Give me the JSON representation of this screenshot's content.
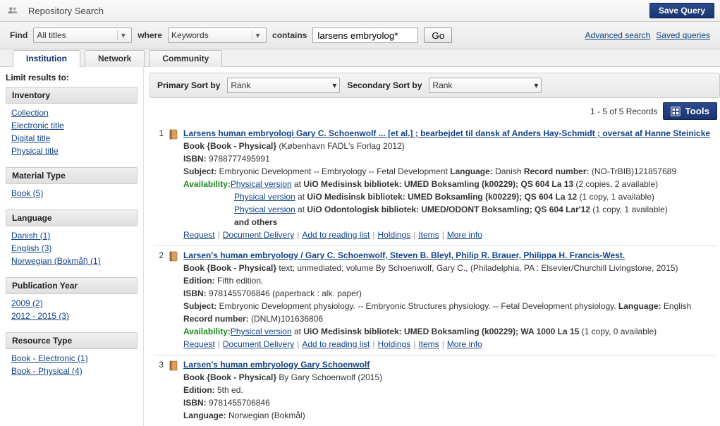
{
  "header": {
    "title": "Repository Search",
    "save_query": "Save Query"
  },
  "search": {
    "find_label": "Find",
    "find_value": "All titles",
    "where_label": "where",
    "where_value": "Keywords",
    "contains_label": "contains",
    "query_value": "larsens embryolog*",
    "go": "Go",
    "advanced": "Advanced search",
    "saved": "Saved queries"
  },
  "tabs": [
    "Institution",
    "Network",
    "Community"
  ],
  "limit_heading": "Limit results to:",
  "facets": [
    {
      "head": "Inventory",
      "items": [
        "Collection",
        "Electronic title",
        "Digital title",
        "Physical title"
      ]
    },
    {
      "head": "Material Type",
      "items": [
        "Book (5)"
      ]
    },
    {
      "head": "Language",
      "items": [
        "Danish (1)",
        "English (3)",
        "Norwegian (Bokmål) (1)"
      ]
    },
    {
      "head": "Publication Year",
      "items": [
        "2009 (2)",
        "2012 - 2015 (3)"
      ]
    },
    {
      "head": "Resource Type",
      "items": [
        "Book - Electronic (1)",
        "Book - Physical (4)"
      ]
    }
  ],
  "sort": {
    "primary_label": "Primary Sort by",
    "primary_value": "Rank",
    "secondary_label": "Secondary Sort by",
    "secondary_value": "Rank"
  },
  "records_count": "1 - 5 of 5 Records",
  "tools": "Tools",
  "action_labels": {
    "request": "Request",
    "docdel": "Document Delivery",
    "reading": "Add to reading list",
    "holdings": "Holdings",
    "items": "Items",
    "more": "More info"
  },
  "results": [
    {
      "num": "1",
      "title": "Larsens human embryologi Gary C. Schoenwolf ... [et al.] ; bearbejdet til dansk af Anders Hay-Schmidt ; oversat af Hanne Steinicke",
      "type": "Book {Book - Physical}",
      "pub": " (København FADL's Forlag 2012)",
      "lines": [
        {
          "parts": [
            {
              "b": "ISBN: "
            },
            {
              "t": "9788777495991"
            }
          ]
        },
        {
          "parts": [
            {
              "b": "Subject: "
            },
            {
              "t": "Embryonic Development -- Embryology -- Fetal Development    "
            },
            {
              "b": "Language: "
            },
            {
              "t": "Danish    "
            },
            {
              "b": "Record number: "
            },
            {
              "t": "(NO-TrBIB)121857689"
            }
          ]
        }
      ],
      "avail": [
        {
          "link": "Physical version",
          "at": " at ",
          "loc": "UiO Medisinsk bibliotek: UMED Boksamling (k00229); QS 604 La 13",
          "copies": " (2 copies, 2 available)"
        },
        {
          "link": "Physical version",
          "at": " at ",
          "loc": "UiO Medisinsk bibliotek: UMED Boksamling (k00229); QS 604 La 12",
          "copies": " (1 copy, 1 available)"
        },
        {
          "link": "Physical version",
          "at": " at ",
          "loc": "UiO Odontologisk bibliotek: UMED/ODONT Boksamling; QS 604 Lar'12",
          "copies": " (1 copy, 1 available)"
        }
      ],
      "others": "and others",
      "actions": true
    },
    {
      "num": "2",
      "title": "Larsen's human embryology / Gary C. Schoenwolf, Steven B. Bleyl, Philip R. Brauer, Philippa H. Francis-West.",
      "type": "Book {Book - Physical}",
      "pub": " text; unmediated; volume By Schoenwolf, Gary C., (Philadelphia, PA : Elsevier/Churchill Livingstone, 2015)",
      "lines": [
        {
          "parts": [
            {
              "b": "Edition: "
            },
            {
              "t": "Fifth edition."
            }
          ]
        },
        {
          "parts": [
            {
              "b": "ISBN: "
            },
            {
              "t": "9781455706846 (paperback : alk. paper)"
            }
          ]
        },
        {
          "parts": [
            {
              "b": "Subject: "
            },
            {
              "t": "Embryonic Development physiology. -- Embryonic Structures physiology. -- Fetal Development physiology.    "
            },
            {
              "b": "Language: "
            },
            {
              "t": "English"
            }
          ]
        },
        {
          "parts": [
            {
              "b": "Record number: "
            },
            {
              "t": "(DNLM)101636806"
            }
          ]
        }
      ],
      "avail": [
        {
          "link": "Physical version",
          "at": " at ",
          "loc": "UiO Medisinsk bibliotek: UMED Boksamling (k00229); WA 1000 La 15",
          "copies": " (1 copy, 0 available)"
        }
      ],
      "actions": true
    },
    {
      "num": "3",
      "title": "Larsen's human embryology Gary Schoenwolf",
      "type": "Book {Book - Physical}",
      "pub": " By Gary Schoenwolf (2015)",
      "lines": [
        {
          "parts": [
            {
              "b": "Edition: "
            },
            {
              "t": "5th ed."
            }
          ]
        },
        {
          "parts": [
            {
              "b": "ISBN: "
            },
            {
              "t": "9781455706846"
            }
          ]
        },
        {
          "parts": [
            {
              "b": "Language: "
            },
            {
              "t": "Norwegian (Bokmål)"
            }
          ]
        }
      ],
      "avail": [],
      "actions": false
    }
  ]
}
